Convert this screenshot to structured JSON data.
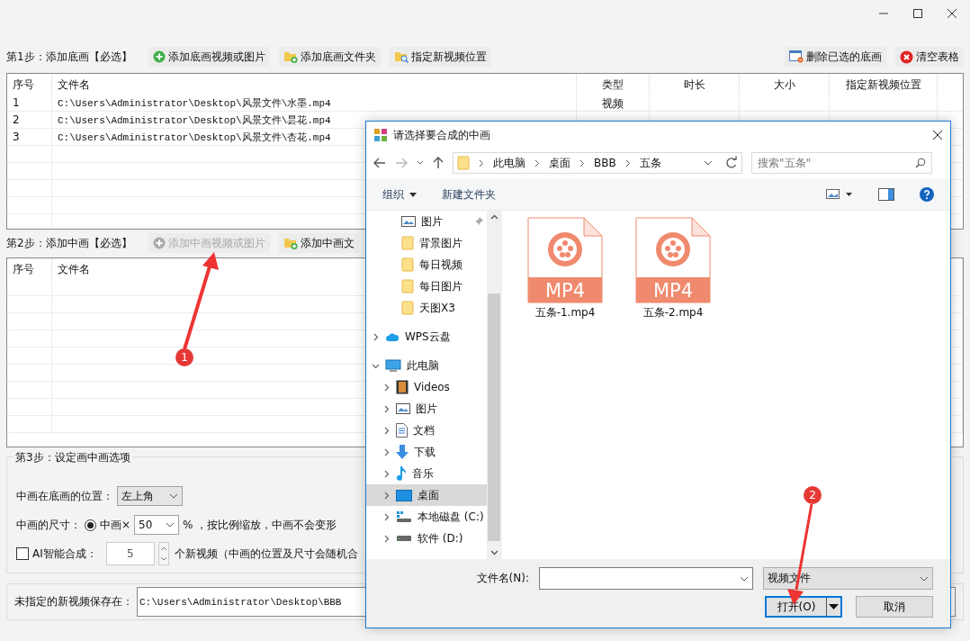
{
  "step1": {
    "label": "第1步：添加底画【必选】",
    "buttons": [
      {
        "label": "添加底画视频或图片",
        "disabled": false
      },
      {
        "label": "添加底画文件夹",
        "disabled": false
      },
      {
        "label": "指定新视频位置",
        "disabled": false
      }
    ],
    "right_buttons": [
      {
        "label": "删除已选的底画",
        "disabled": false
      },
      {
        "label": "清空表格",
        "disabled": false
      }
    ]
  },
  "table1": {
    "columns": [
      "序号",
      "文件名",
      "类型",
      "时长",
      "大小",
      "指定新视频位置"
    ],
    "rows": [
      [
        "1",
        "C:\\Users\\Administrator\\Desktop\\风景文件\\水墨.mp4",
        "视频"
      ],
      [
        "2",
        "C:\\Users\\Administrator\\Desktop\\风景文件\\昙花.mp4"
      ],
      [
        "3",
        "C:\\Users\\Administrator\\Desktop\\风景文件\\杏花.mp4"
      ]
    ]
  },
  "step2": {
    "label": "第2步：添加中画【必选】",
    "buttons": [
      {
        "label": "添加中画视频或图片",
        "disabled": true
      },
      {
        "label": "添加中画文",
        "disabled": false
      }
    ]
  },
  "table2": {
    "columns": [
      "序号",
      "文件名"
    ]
  },
  "step3": {
    "title": "第3步：设定画中画选项",
    "position_label": "中画在底画的位置：",
    "position_value": "左上角",
    "size_label": "中画的尺寸：",
    "size_options": [
      {
        "label": "中画×",
        "selected": true,
        "value": "50",
        "suffix": "% ，按比例缩放，中画不会变形"
      }
    ],
    "ai": {
      "label": "AI智能合成：",
      "checked": false,
      "count": "5",
      "suffix": "个新视频（中画的位置及尺寸会随机合"
    }
  },
  "save": {
    "label": "未指定的新视频保存在：",
    "path": "C:\\Users\\Administrator\\Desktop\\BBB"
  },
  "dialog": {
    "title": "请选择要合成的中画",
    "breadcrumb": [
      "此电脑",
      "桌面",
      "BBB",
      "五条"
    ],
    "search_placeholder": "搜索\"五条\"",
    "commands": [
      "组织",
      "新建文件夹"
    ],
    "nav": [
      {
        "label": "图片",
        "pinned": true,
        "selected": false
      },
      {
        "label": "背景图片",
        "selected": false
      },
      {
        "label": "每日视频",
        "selected": false
      },
      {
        "label": "每日图片",
        "selected": false
      },
      {
        "label": "天图X3",
        "selected": false
      },
      {
        "label": "WPS云盘",
        "expanded": false,
        "selected": false
      },
      {
        "label": "此电脑",
        "expanded": true,
        "selected": false,
        "children": [
          {
            "label": "Videos",
            "expanded": false,
            "selected": false
          },
          {
            "label": "图片",
            "expanded": false,
            "selected": false
          },
          {
            "label": "文档",
            "expanded": false,
            "selected": false
          },
          {
            "label": "下载",
            "expanded": false,
            "selected": false
          },
          {
            "label": "音乐",
            "expanded": false,
            "selected": false
          },
          {
            "label": "桌面",
            "expanded": false,
            "selected": true
          },
          {
            "label": "本地磁盘 (C:)",
            "expanded": false,
            "selected": false
          },
          {
            "label": "软件 (D:)",
            "expanded": false,
            "selected": false
          }
        ]
      }
    ],
    "files": [
      {
        "name": "五条-1.mp4",
        "badge": "MP4"
      },
      {
        "name": "五条-2.mp4",
        "badge": "MP4"
      }
    ],
    "filename_label": "文件名(N):",
    "filter": "视频文件",
    "buttons": [
      {
        "label": "打开(O)",
        "default": true
      },
      {
        "label": "取消",
        "default": false
      }
    ]
  },
  "annotations": [
    {
      "number": "1"
    },
    {
      "number": "2"
    }
  ]
}
